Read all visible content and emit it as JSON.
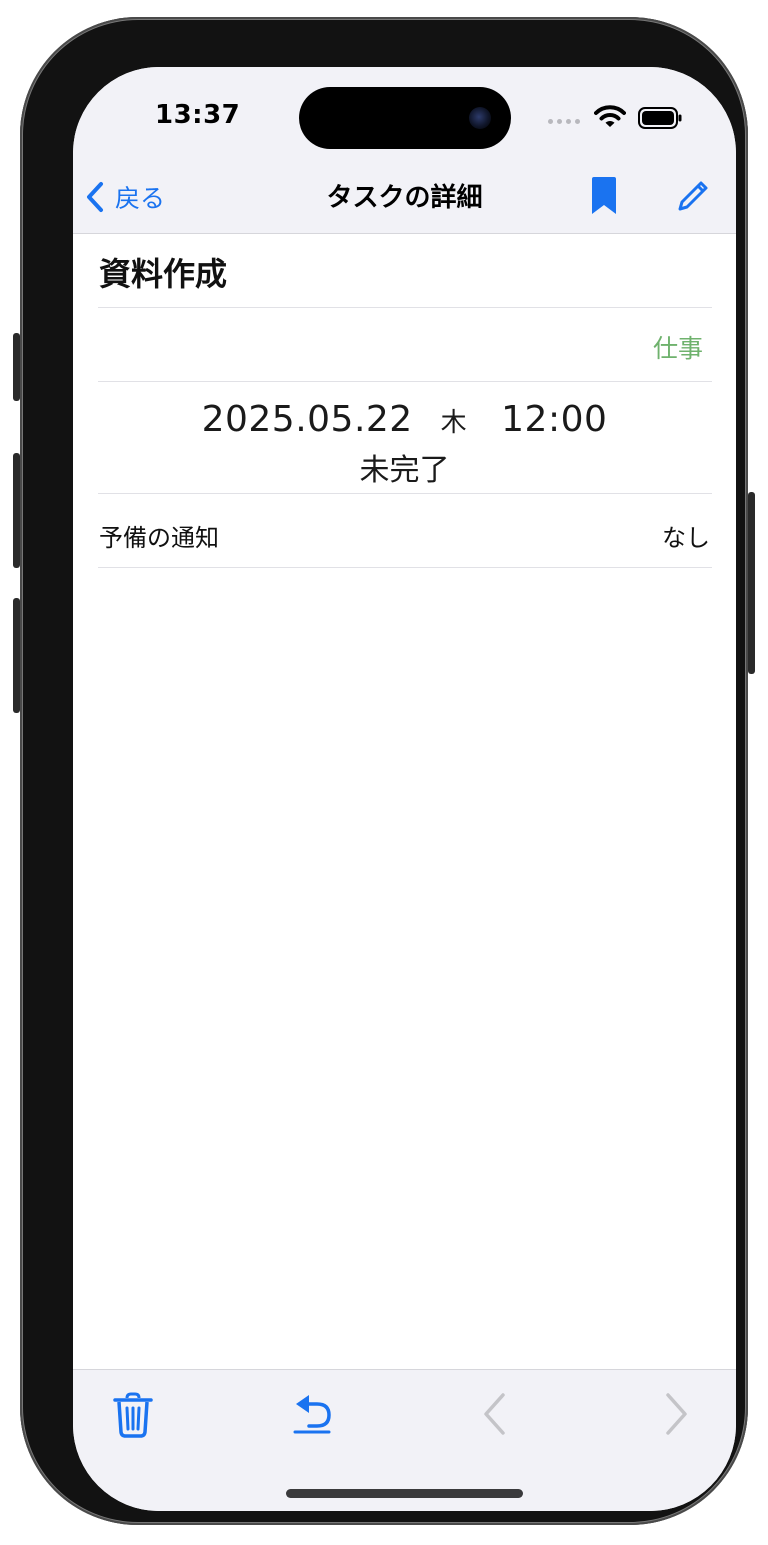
{
  "status_bar": {
    "time": "13:37"
  },
  "nav": {
    "back_label": "戻る",
    "title": "タスクの詳細"
  },
  "task": {
    "title": "資料作成",
    "category": "仕事",
    "date": "2025.05.22",
    "weekday": "木",
    "time": "12:00",
    "status": "未完了",
    "backup_notification_label": "予備の通知",
    "backup_notification_value": "なし"
  },
  "colors": {
    "accent": "#1a73f0",
    "category": "#6fb26d",
    "disabled": "#c4c4c8"
  },
  "toolbar": {
    "icons": [
      "trash-icon",
      "undo-icon",
      "chevron-left-icon",
      "chevron-right-icon"
    ]
  }
}
